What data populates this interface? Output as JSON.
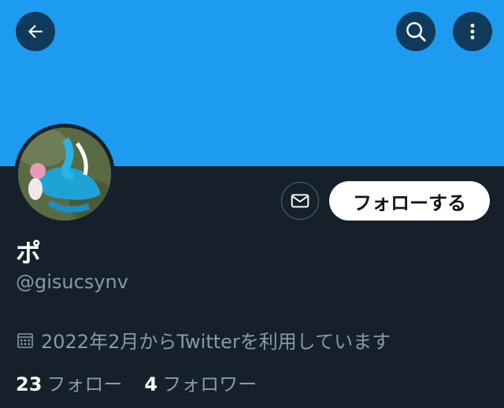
{
  "header": {
    "back_icon": "arrow-left-icon",
    "search_icon": "search-icon",
    "more_icon": "more-vertical-icon",
    "banner_color": "#1d9bf0"
  },
  "profile": {
    "name": "ポ",
    "handle": "@gisucsynv",
    "joined": "2022年2月からTwitterを利用しています",
    "follow_label": "フォローする",
    "dm_icon": "envelope-icon",
    "calendar_icon": "calendar-icon"
  },
  "stats": {
    "following_count": "23",
    "following_label": "フォロー",
    "followers_count": "4",
    "followers_label": "フォロワー"
  }
}
